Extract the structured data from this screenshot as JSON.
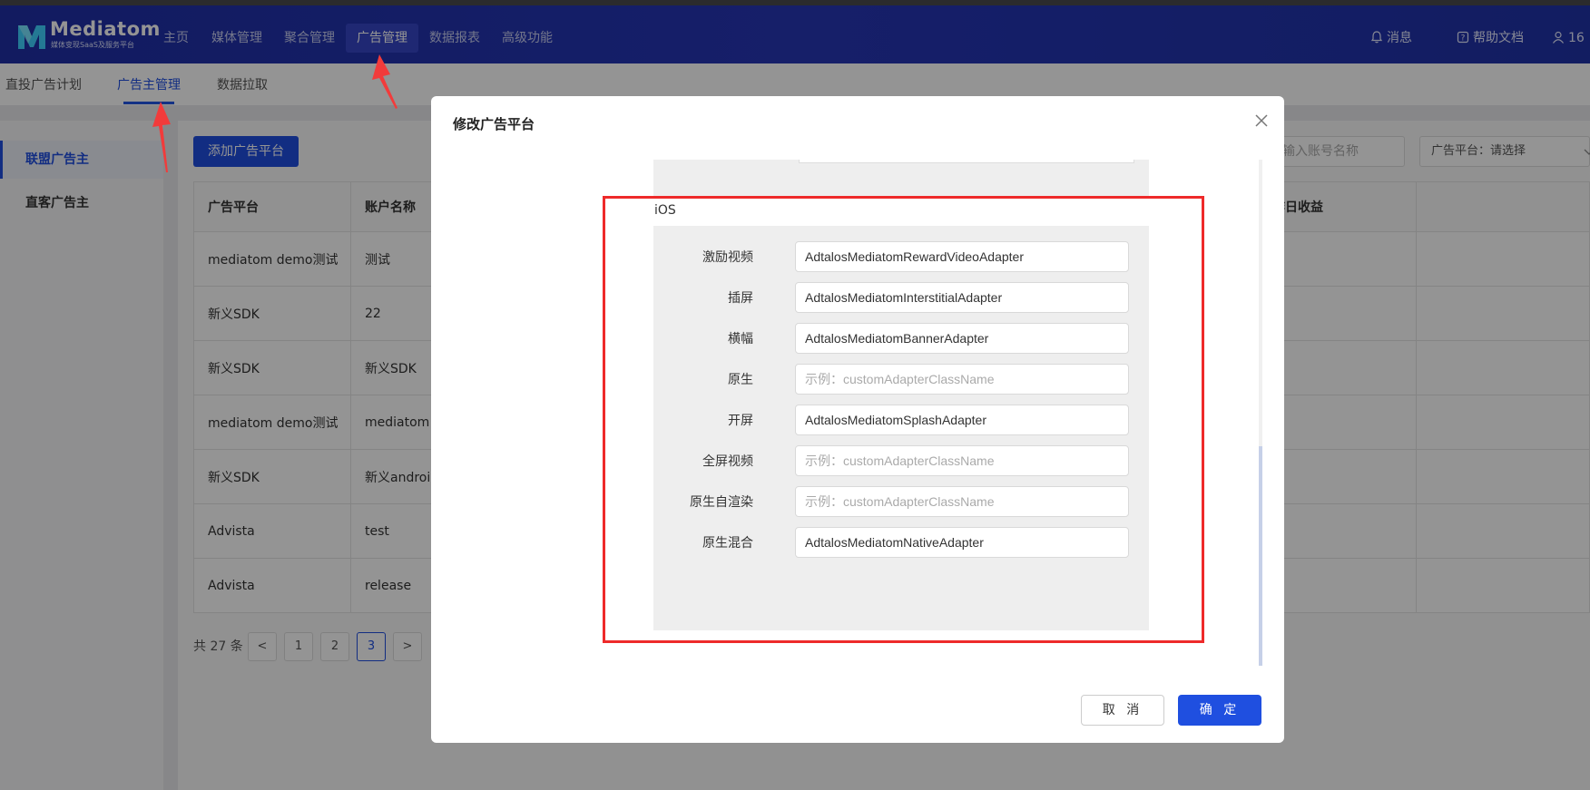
{
  "brand": {
    "name": "Mediatom",
    "tagline": "媒体变现SaaS及服务平台"
  },
  "topnav": {
    "items": [
      "主页",
      "媒体管理",
      "聚合管理",
      "广告管理",
      "数据报表",
      "高级功能"
    ],
    "active_index": 3,
    "messages": "消息",
    "help": "帮助文档",
    "user": "16"
  },
  "subnav": {
    "items": [
      "直投广告计划",
      "广告主管理",
      "数据拉取"
    ],
    "active_index": 1
  },
  "sidebar": {
    "items": [
      "联盟广告主",
      "直客广告主"
    ],
    "active_index": 0
  },
  "toolbar": {
    "add_button": "添加广告平台",
    "account_search_placeholder": "输入账号名称",
    "platform_select": "广告平台：请选择"
  },
  "table": {
    "headers": [
      "广告平台",
      "账户名称",
      "昨日收益"
    ],
    "rows": [
      [
        "mediatom demo测试",
        "测试",
        "--"
      ],
      [
        "新义SDK",
        "22",
        "--"
      ],
      [
        "新义SDK",
        "新义SDK",
        "--"
      ],
      [
        "mediatom demo测试",
        "mediatom d",
        "--"
      ],
      [
        "新义SDK",
        "新义androi",
        "--"
      ],
      [
        "Advista",
        "test",
        "--"
      ],
      [
        "Advista",
        "release",
        "--"
      ]
    ]
  },
  "pagination": {
    "total": "共 27 条",
    "pages": [
      "1",
      "2",
      "3"
    ],
    "current": "3",
    "prev": "<",
    "next": ">"
  },
  "modal": {
    "title": "修改广告平台",
    "section_label": "iOS",
    "fields": [
      {
        "label": "激励视频",
        "value": "AdtalosMediatomRewardVideoAdapter",
        "placeholder": false
      },
      {
        "label": "插屏",
        "value": "AdtalosMediatomInterstitialAdapter",
        "placeholder": false
      },
      {
        "label": "横幅",
        "value": "AdtalosMediatomBannerAdapter",
        "placeholder": false
      },
      {
        "label": "原生",
        "value": "示例：customAdapterClassName",
        "placeholder": true
      },
      {
        "label": "开屏",
        "value": "AdtalosMediatomSplashAdapter",
        "placeholder": false
      },
      {
        "label": "全屏视频",
        "value": "示例：customAdapterClassName",
        "placeholder": true
      },
      {
        "label": "原生自渲染",
        "value": "示例：customAdapterClassName",
        "placeholder": true
      },
      {
        "label": "原生混合",
        "value": "AdtalosMediatomNativeAdapter",
        "placeholder": false
      }
    ],
    "cancel": "取 消",
    "confirm": "确 定"
  },
  "colors": {
    "nav_bg": "#1f2fa6",
    "primary": "#1f4fe0",
    "highlight": "#ee2a2a",
    "arrow": "#f23b3b"
  }
}
